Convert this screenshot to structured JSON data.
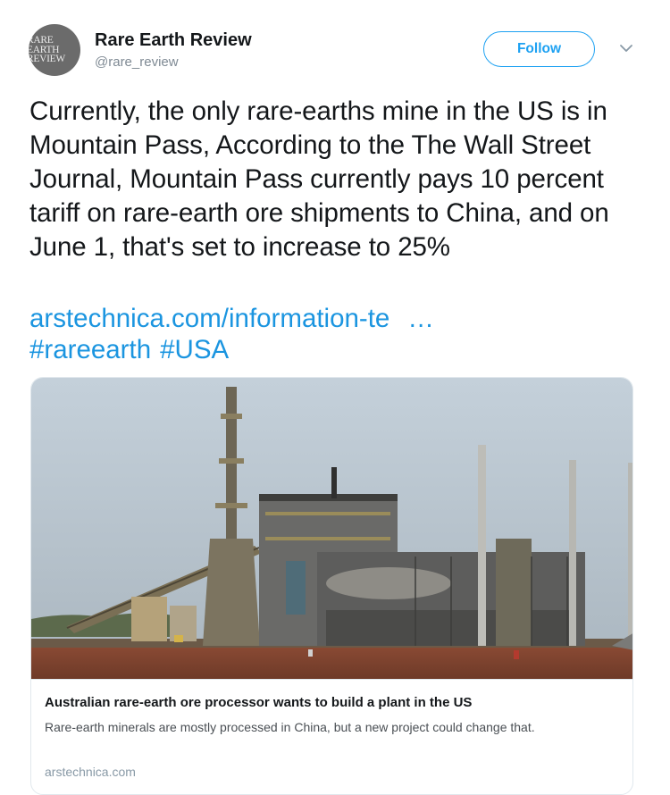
{
  "author": {
    "avatar_lines": [
      "RARE",
      "EARTH",
      "REVIEW"
    ],
    "name": "Rare Earth Review",
    "handle": "@rare_review"
  },
  "follow_label": "Follow",
  "tweet": {
    "text": "Currently, the only rare-earths mine in the US is in Mountain Pass, According to the The Wall Street Journal, Mountain Pass currently pays 10 percent tariff on rare-earth ore shipments to China, and on June 1, that's set to increase to 25%",
    "link": "arstechnica.com/information-te",
    "ellipsis": "…",
    "hashtags": [
      "#rareearth",
      "#USA"
    ]
  },
  "card": {
    "title": "Australian rare-earth ore processor wants to build a plant in the US",
    "description": "Rare-earth minerals are mostly processed in China, but a new project could change that.",
    "domain": "arstechnica.com"
  },
  "colors": {
    "link": "#1b95e0",
    "follow_accent": "#1da1f2",
    "muted": "#7f8a94"
  },
  "icons": {
    "caret": "chevron-down-icon"
  }
}
